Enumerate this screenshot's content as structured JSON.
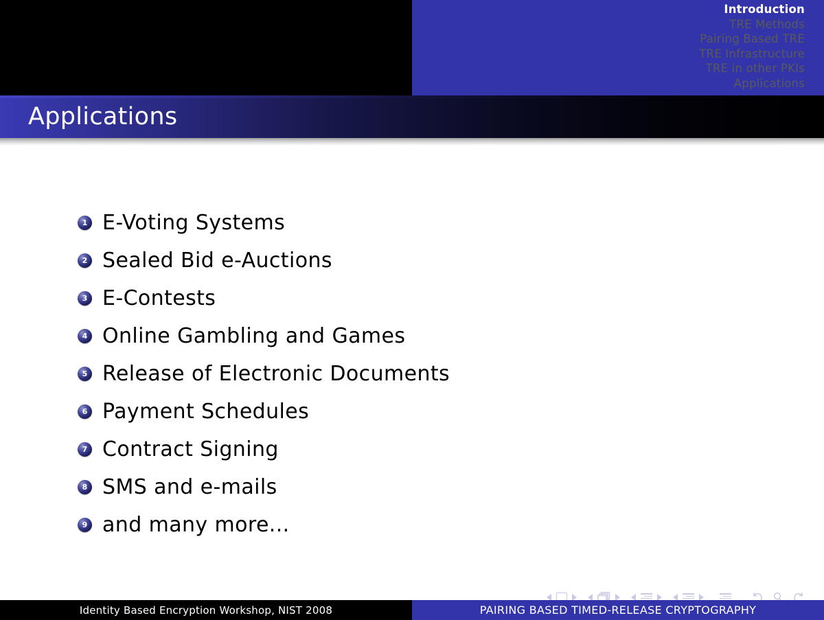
{
  "header": {
    "nav_items": [
      {
        "label": "Introduction",
        "active": true
      },
      {
        "label": "TRE Methods",
        "active": false
      },
      {
        "label": "Pairing Based TRE",
        "active": false
      },
      {
        "label": "TRE Infrastructure",
        "active": false
      },
      {
        "label": "TRE in other PKIs",
        "active": false
      },
      {
        "label": "Applications",
        "active": false
      }
    ]
  },
  "title": {
    "text": "Applications"
  },
  "content": {
    "items": [
      {
        "number": "1",
        "label": "E-Voting Systems"
      },
      {
        "number": "2",
        "label": "Sealed Bid e-Auctions"
      },
      {
        "number": "3",
        "label": "E-Contests"
      },
      {
        "number": "4",
        "label": "Online Gambling and Games"
      },
      {
        "number": "5",
        "label": "Release of Electronic Documents"
      },
      {
        "number": "6",
        "label": "Payment Schedules"
      },
      {
        "number": "7",
        "label": "Contract Signing"
      },
      {
        "number": "8",
        "label": "SMS and e-mails"
      },
      {
        "number": "9",
        "label": "and many more..."
      }
    ]
  },
  "footer": {
    "left_text": "Identity Based Encryption Workshop, NIST 2008",
    "right_text": "PAIRING BASED TIMED-RELEASE CRYPTOGRAPHY"
  },
  "colors": {
    "accent_blue": "#3333aa",
    "header_black": "#000000",
    "bullet_navy": "#26276e",
    "nav_symbol": "#c9c9e4",
    "text_black": "#000000",
    "nav_inactive": "#5a5a5a"
  }
}
